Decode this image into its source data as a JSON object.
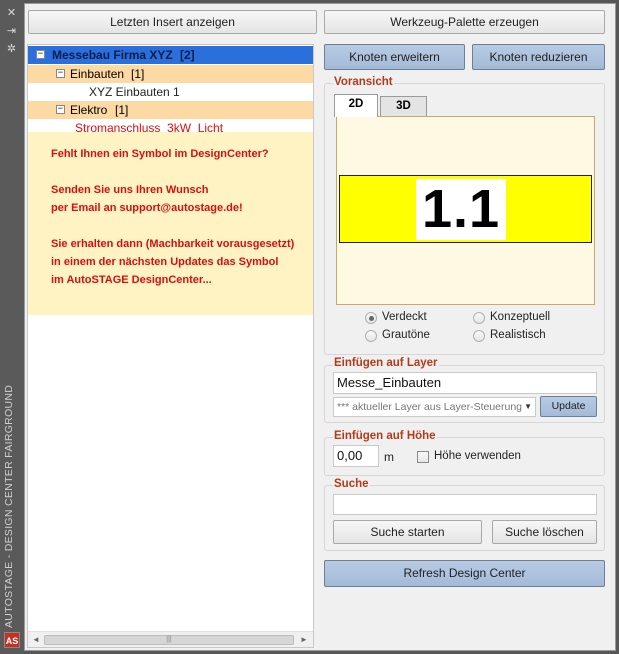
{
  "sidebar": {
    "vertical_title": "AUTOSTAGE - DESIGN CENTER FAIRGROUND",
    "logo_text": "AS",
    "controls": [
      "close-icon",
      "pin-icon",
      "settings-icon"
    ]
  },
  "toolbar": {
    "last_insert_label": "Letzten Insert anzeigen",
    "tool_palette_label": "Werkzeug-Palette erzeugen",
    "expand_nodes_label": "Knoten erweitern",
    "reduce_nodes_label": "Knoten reduzieren"
  },
  "tree": {
    "root": {
      "label": "Messebau Firma XYZ",
      "count": "[2]",
      "expander": "−"
    },
    "children": [
      {
        "label": "Einbauten",
        "count": "[1]",
        "expander": "−",
        "items": [
          "XYZ Einbauten 1"
        ]
      },
      {
        "label": "Elektro",
        "count": "[1]",
        "expander": "−",
        "items": [
          "Stromanschluss_3kW_Licht"
        ]
      }
    ],
    "message_lines": [
      "Fehlt Ihnen ein Symbol im DesignCenter?",
      "",
      "Senden Sie uns Ihren Wunsch",
      "per Email an support@autostage.de!",
      "",
      "Sie erhalten dann (Machbarkeit vorausgesetzt)",
      "in einem der nächsten Updates das Symbol",
      "im AutoSTAGE DesignCenter..."
    ],
    "scroll_left": "◄",
    "scroll_right": "►",
    "scroll_grip": "|||"
  },
  "preview": {
    "title": "Voransicht",
    "tabs": [
      "2D",
      "3D"
    ],
    "active_tab": "2D",
    "symbol_text": "1.1",
    "symbol_bg": "#ffff00",
    "visual_styles": [
      {
        "label": "Verdeckt",
        "selected": true
      },
      {
        "label": "Konzeptuell",
        "selected": false
      },
      {
        "label": "Grautöne",
        "selected": false
      },
      {
        "label": "Realistisch",
        "selected": false
      }
    ]
  },
  "layer": {
    "title": "Einfügen auf Layer",
    "value": "Messe_Einbauten",
    "combo_text": "*** aktueller Layer aus Layer-Steuerung",
    "update_label": "Update"
  },
  "height": {
    "title": "Einfügen auf Höhe",
    "value": "0,00",
    "unit": "m",
    "use_height_label": "Höhe verwenden",
    "use_height_checked": false
  },
  "search": {
    "title": "Suche",
    "value": "",
    "start_label": "Suche starten",
    "clear_label": "Suche löschen"
  },
  "refresh_label": "Refresh Design Center",
  "colors": {
    "accent_blue": "#a9bfdc",
    "selection_blue": "#2b6fdc",
    "group_title": "#b43a1a",
    "tree_category_bg": "#fdd9a4",
    "message_red": "#d41010",
    "message_bg": "#fff3c4"
  }
}
